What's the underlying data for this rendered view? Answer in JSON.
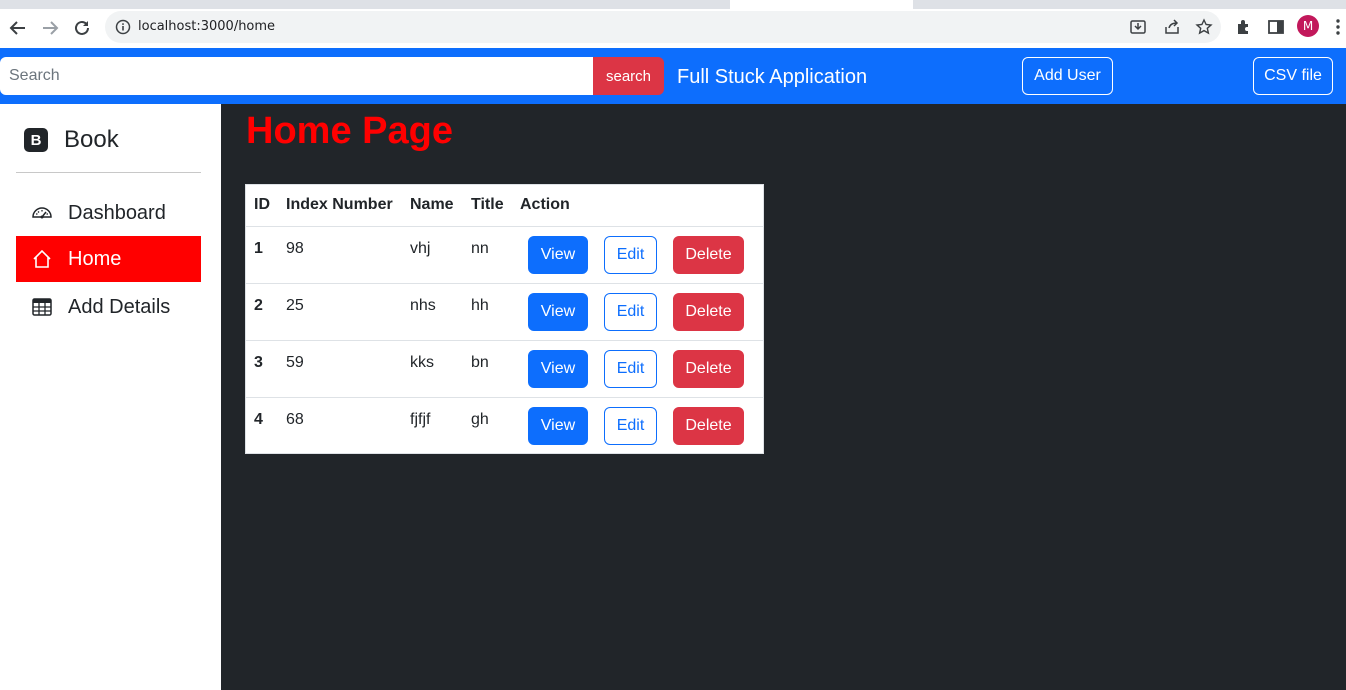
{
  "browser": {
    "url": "localhost:3000/home",
    "profile_initial": "M",
    "profile_color": "#c2185b"
  },
  "navbar": {
    "search_placeholder": "Search",
    "search_button": "search",
    "brand": "Full Stuck Application",
    "add_user_button": "Add User",
    "csv_button": "CSV file",
    "color": "#0d6efd"
  },
  "sidebar": {
    "logo_letter": "B",
    "brand": "Book",
    "items": [
      {
        "label": "Dashboard",
        "icon": "speedometer-icon",
        "active": false
      },
      {
        "label": "Home",
        "icon": "house-icon",
        "active": true
      },
      {
        "label": "Add Details",
        "icon": "table-icon",
        "active": false
      }
    ]
  },
  "main": {
    "title": "Home Page",
    "table": {
      "headers": [
        "ID",
        "Index Number",
        "Name",
        "Title",
        "Action"
      ],
      "rows": [
        {
          "id": "1",
          "index": "98",
          "name": "vhj",
          "title": "nn"
        },
        {
          "id": "2",
          "index": "25",
          "name": "nhs",
          "title": "hh"
        },
        {
          "id": "3",
          "index": "59",
          "name": "kks",
          "title": "bn"
        },
        {
          "id": "4",
          "index": "68",
          "name": "fjfjf",
          "title": "gh"
        }
      ],
      "view_label": "View",
      "edit_label": "Edit",
      "delete_label": "Delete"
    }
  }
}
